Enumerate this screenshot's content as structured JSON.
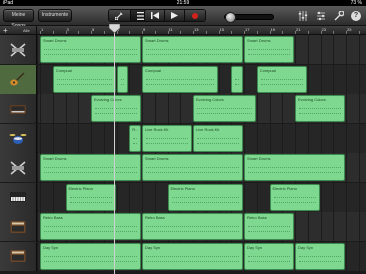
{
  "status": {
    "carrier": "iPad",
    "clock": "21:59",
    "battery": "73 %"
  },
  "toolbar": {
    "songs_label": "Meine Songs",
    "instruments_label": "Instrumente",
    "view_buttons": [
      "guitar-view-icon",
      "tracks-view-icon"
    ],
    "transport": [
      "rewind-icon",
      "play-icon",
      "record-icon"
    ],
    "volume_level": 0.05,
    "right_icons": [
      "mixer-icon",
      "settings-icon",
      "wrench-icon",
      "help-icon"
    ],
    "help_label": "?"
  },
  "ruler": {
    "add_label": "+",
    "all_label": "Alle",
    "bars": [
      "1",
      "3",
      "5",
      "7",
      "9",
      "11",
      "13",
      "15",
      "17",
      "19",
      "21",
      "23",
      "25"
    ]
  },
  "accent_colors": {
    "region": "#7fd88f",
    "region_border": "#3d8a4e",
    "record": "#d2231d"
  },
  "tracks": [
    {
      "instrument": "drum-machine-icon",
      "selected": false,
      "regions": [
        {
          "name": "Smart Drums"
        },
        {
          "name": "Smart Drums"
        },
        {
          "name": "Smart Drums"
        }
      ]
    },
    {
      "instrument": "guitar-icon",
      "selected": true,
      "regions": [
        {
          "name": "Compuai"
        },
        {
          "name": ""
        },
        {
          "name": "Compuai"
        },
        {
          "name": ""
        },
        {
          "name": "Compuai"
        }
      ]
    },
    {
      "instrument": "keyboard-amp-icon",
      "selected": false,
      "regions": [
        {
          "name": "Evolving Colors"
        },
        {
          "name": "Evolving Colors"
        },
        {
          "name": "Evolving Colors"
        }
      ]
    },
    {
      "instrument": "drum-kit-icon",
      "selected": false,
      "regions": [
        {
          "name": "R..."
        },
        {
          "name": "Live Rock Kit"
        },
        {
          "name": "Live Rock Kit"
        }
      ]
    },
    {
      "instrument": "drum-machine-icon",
      "selected": false,
      "regions": [
        {
          "name": "Smart Drums"
        },
        {
          "name": "Smart Drums"
        },
        {
          "name": "Smart Drums"
        }
      ]
    },
    {
      "instrument": "piano-icon",
      "selected": false,
      "regions": [
        {
          "name": "Electric Piano"
        },
        {
          "name": "Electric Piano"
        },
        {
          "name": "Electric Piano"
        }
      ]
    },
    {
      "instrument": "bass-amp-icon",
      "selected": false,
      "regions": [
        {
          "name": "Retro Bass"
        },
        {
          "name": "Retro Bass"
        },
        {
          "name": "Retro Bass"
        }
      ]
    },
    {
      "instrument": "bass-amp-icon",
      "selected": false,
      "regions": [
        {
          "name": "Day Syn"
        },
        {
          "name": "Day Syn"
        },
        {
          "name": "Day Syn"
        },
        {
          "name": "Day Syn"
        }
      ]
    }
  ]
}
